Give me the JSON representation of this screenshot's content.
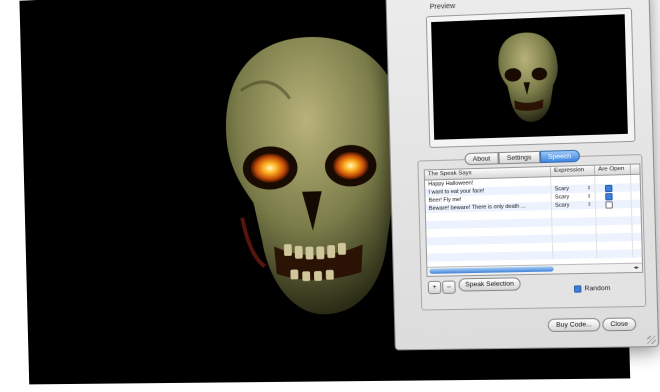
{
  "window": {
    "preview_label": "Preview",
    "tabs": [
      {
        "label": "About",
        "active": false
      },
      {
        "label": "Settings",
        "active": false
      },
      {
        "label": "Speech",
        "active": true
      }
    ],
    "table": {
      "columns": [
        "The Speak Says",
        "Expression",
        "Are Open"
      ],
      "rows": [
        {
          "text": "Happy Halloween!",
          "expression": "",
          "checked": null
        },
        {
          "text": "I want to eat your face!",
          "expression": "Scary",
          "checked": true
        },
        {
          "text": "Beer! Fly me!",
          "expression": "Scary",
          "checked": true
        },
        {
          "text": "Beware! beware! There is only death ...",
          "expression": "Scary",
          "checked": false
        },
        {
          "text": "",
          "expression": "",
          "checked": null
        },
        {
          "text": "",
          "expression": "",
          "checked": null
        },
        {
          "text": "",
          "expression": "",
          "checked": null
        },
        {
          "text": "",
          "expression": "",
          "checked": null
        },
        {
          "text": "",
          "expression": "",
          "checked": null
        },
        {
          "text": "",
          "expression": "",
          "checked": null
        }
      ]
    },
    "add_label": "+",
    "remove_label": "–",
    "speak_selection_label": "Speak Selection",
    "random_label": "Random",
    "random_checked": true,
    "buy_label": "Buy Code...",
    "close_label": "Close"
  },
  "icons": {
    "skull": "skull-icon",
    "stepper": "stepper-icon",
    "resize": "resize-grip-icon"
  },
  "colors": {
    "accent": "#3d86e0",
    "canvas": "#000000",
    "eye_glow": "#ffb020"
  }
}
